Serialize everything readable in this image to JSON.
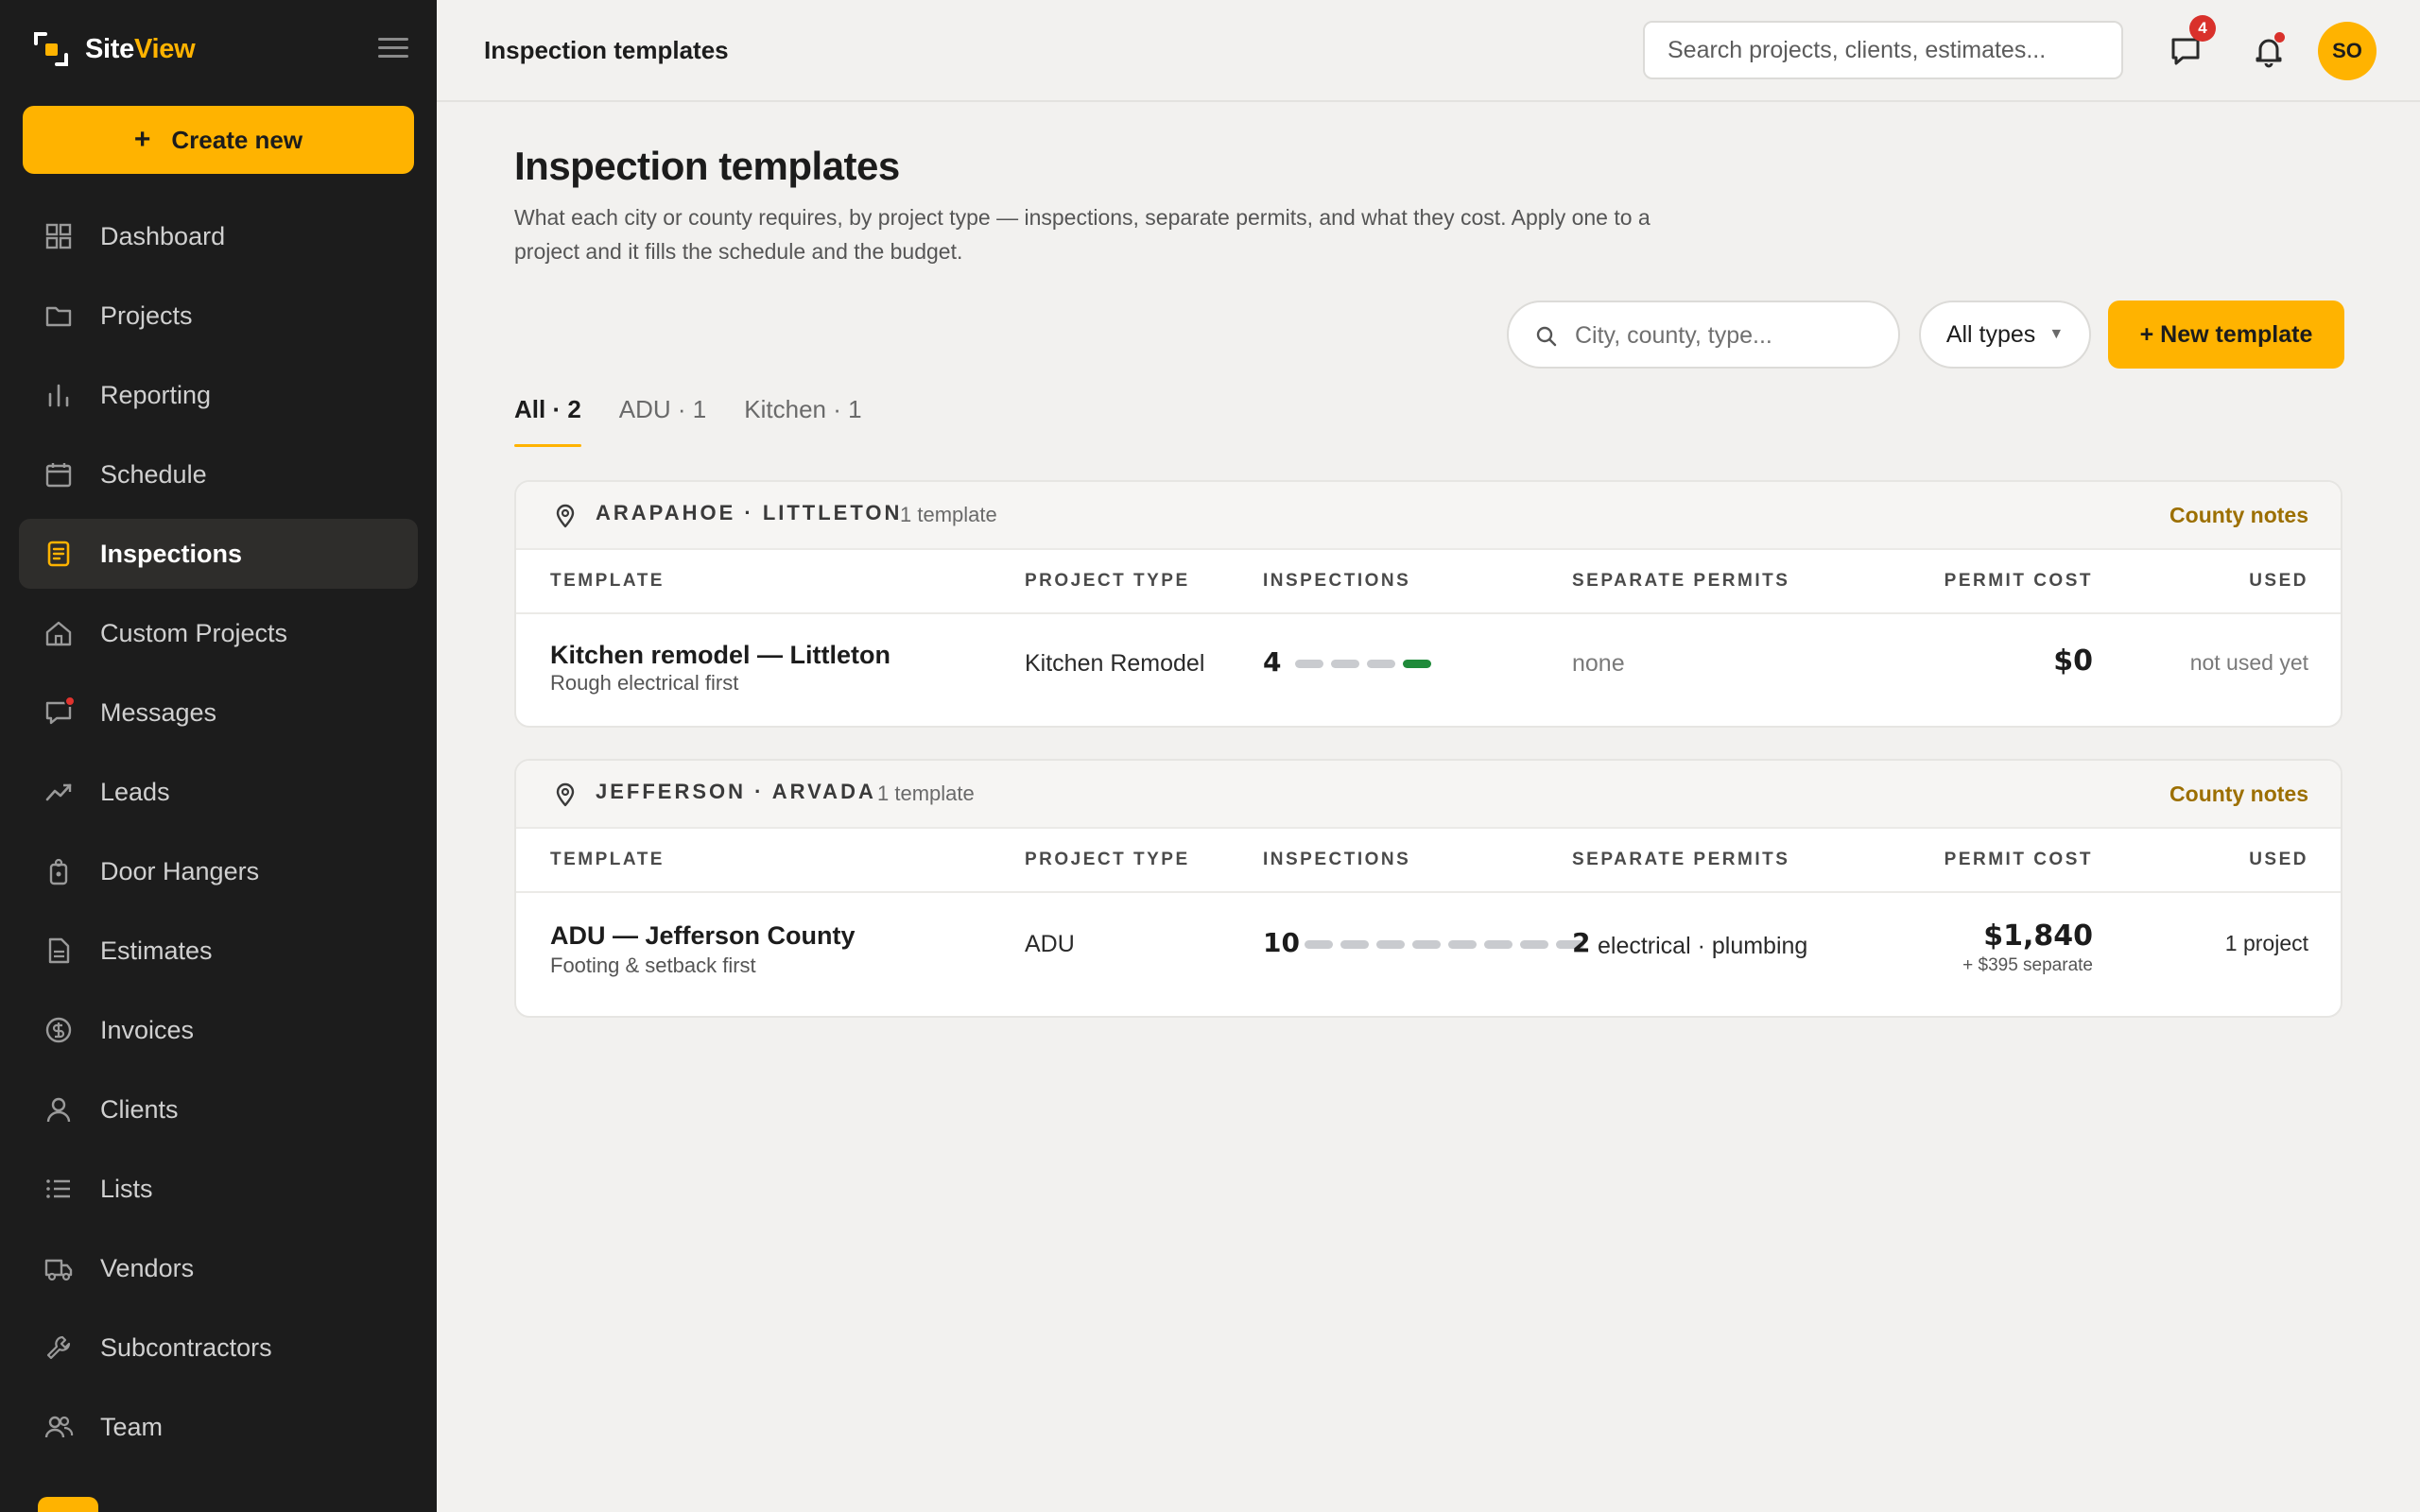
{
  "brand": {
    "name_part1": "Site",
    "name_part2": "View",
    "accent_color": "#ffb300"
  },
  "sidebar": {
    "create_label": "Create new",
    "items": [
      {
        "label": "Dashboard",
        "icon": "grid-icon"
      },
      {
        "label": "Projects",
        "icon": "folder-icon"
      },
      {
        "label": "Reporting",
        "icon": "bar-chart-icon"
      },
      {
        "label": "Schedule",
        "icon": "calendar-icon"
      },
      {
        "label": "Inspections",
        "icon": "clipboard-icon",
        "active": true
      },
      {
        "label": "Custom Projects",
        "icon": "home-icon"
      },
      {
        "label": "Messages",
        "icon": "chat-icon",
        "has_dot": true
      },
      {
        "label": "Leads",
        "icon": "trend-icon"
      },
      {
        "label": "Door Hangers",
        "icon": "tag-icon"
      },
      {
        "label": "Estimates",
        "icon": "document-icon"
      },
      {
        "label": "Invoices",
        "icon": "dollar-icon"
      },
      {
        "label": "Clients",
        "icon": "user-icon"
      },
      {
        "label": "Lists",
        "icon": "list-icon"
      },
      {
        "label": "Vendors",
        "icon": "truck-icon"
      },
      {
        "label": "Subcontractors",
        "icon": "wrench-icon"
      },
      {
        "label": "Team",
        "icon": "team-icon"
      }
    ]
  },
  "topbar": {
    "title": "Inspection templates",
    "search_placeholder": "Search projects, clients, estimates...",
    "messages_count": "4",
    "avatar_initials": "SO"
  },
  "main": {
    "title": "Inspection templates",
    "description": "What each city or county requires, by project type — inspections, separate permits, and what they cost. Apply one to a project and it fills the schedule and the budget.",
    "filter_placeholder": "City, county, type...",
    "type_filter": "All types",
    "new_template_label": "+ New template",
    "tabs": [
      {
        "label": "All · 2",
        "active": true
      },
      {
        "label": "ADU · 1"
      },
      {
        "label": "Kitchen · 1"
      }
    ],
    "columns": {
      "template": "TEMPLATE",
      "project_type": "PROJECT TYPE",
      "inspections": "INSPECTIONS",
      "separate_permits": "SEPARATE PERMITS",
      "permit_cost": "PERMIT COST",
      "used": "USED"
    },
    "groups": [
      {
        "location": "ARAPAHOE · LITTLETON",
        "count_label": "1 template",
        "notes_label": "County notes",
        "rows": [
          {
            "name": "Kitchen remodel — Littleton",
            "subtitle": "Rough electrical first",
            "project_type": "Kitchen Remodel",
            "inspections": "4",
            "inspection_steps_total": 4,
            "inspection_steps_done": 1,
            "separate_permits_count": "",
            "separate_permits": "none",
            "permit_cost": "$0",
            "permit_cost_sub": "",
            "used": "not used yet"
          }
        ]
      },
      {
        "location": "JEFFERSON · ARVADA",
        "count_label": "1 template",
        "notes_label": "County notes",
        "rows": [
          {
            "name": "ADU — Jefferson County",
            "subtitle": "Footing & setback first",
            "project_type": "ADU",
            "inspections": "10",
            "inspection_steps_total": 8,
            "inspection_steps_done": 0,
            "separate_permits_count": "2",
            "separate_permits": "electrical · plumbing",
            "permit_cost": "$1,840",
            "permit_cost_sub": "+ $395 separate",
            "used": "1 project"
          }
        ]
      }
    ]
  }
}
